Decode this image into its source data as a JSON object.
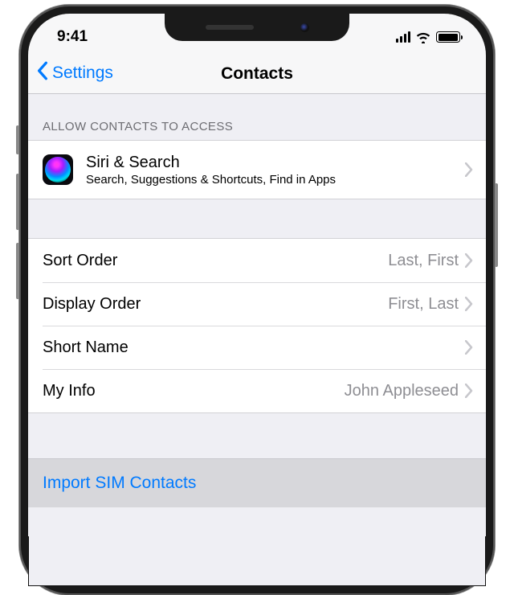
{
  "status": {
    "time": "9:41"
  },
  "nav": {
    "back_label": "Settings",
    "title": "Contacts"
  },
  "sections": {
    "access_header": "Allow Contacts to Access",
    "siri": {
      "title": "Siri & Search",
      "subtitle": "Search, Suggestions & Shortcuts, Find in Apps"
    },
    "rows": {
      "sort_order": {
        "label": "Sort Order",
        "value": "Last, First"
      },
      "display_order": {
        "label": "Display Order",
        "value": "First, Last"
      },
      "short_name": {
        "label": "Short Name",
        "value": ""
      },
      "my_info": {
        "label": "My Info",
        "value": "John Appleseed"
      }
    },
    "import_label": "Import SIM Contacts"
  },
  "colors": {
    "tint": "#007aff",
    "group_bg": "#efeff4",
    "cell_bg": "#ffffff",
    "secondary_text": "#8e8e93"
  }
}
